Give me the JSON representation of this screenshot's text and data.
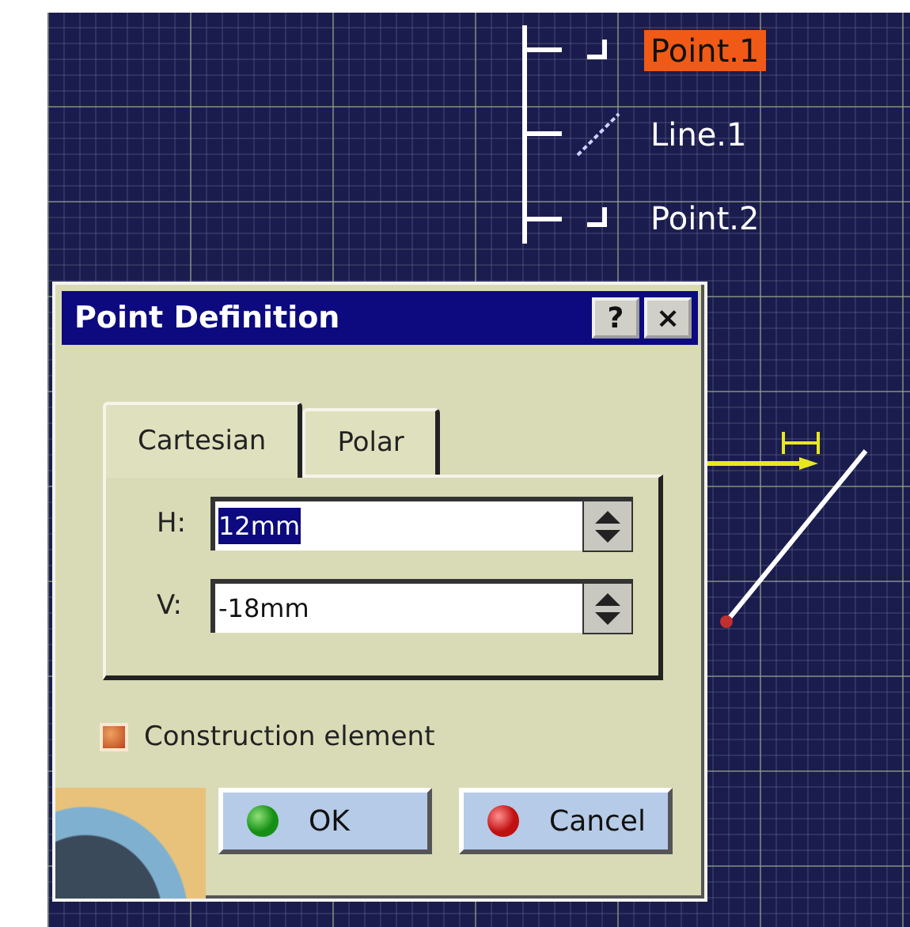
{
  "tree": {
    "items": [
      {
        "kind": "point",
        "label": "Point.1",
        "selected": true
      },
      {
        "kind": "line",
        "label": "Line.1",
        "selected": false
      },
      {
        "kind": "point",
        "label": "Point.2",
        "selected": false
      }
    ]
  },
  "dialog": {
    "title": "Point Definition",
    "help": "?",
    "close": "×",
    "tabs": [
      {
        "label": "Cartesian",
        "selected": true
      },
      {
        "label": "Polar",
        "selected": false
      }
    ],
    "fields": [
      {
        "label": "H:",
        "value": "12mm",
        "text_selected": true
      },
      {
        "label": "V:",
        "value": "-18mm",
        "text_selected": false
      }
    ],
    "checkbox": {
      "label": "Construction element",
      "checked": true
    },
    "buttons": [
      {
        "kind": "ok",
        "label": "OK"
      },
      {
        "kind": "cancel",
        "label": "Cancel"
      }
    ]
  }
}
